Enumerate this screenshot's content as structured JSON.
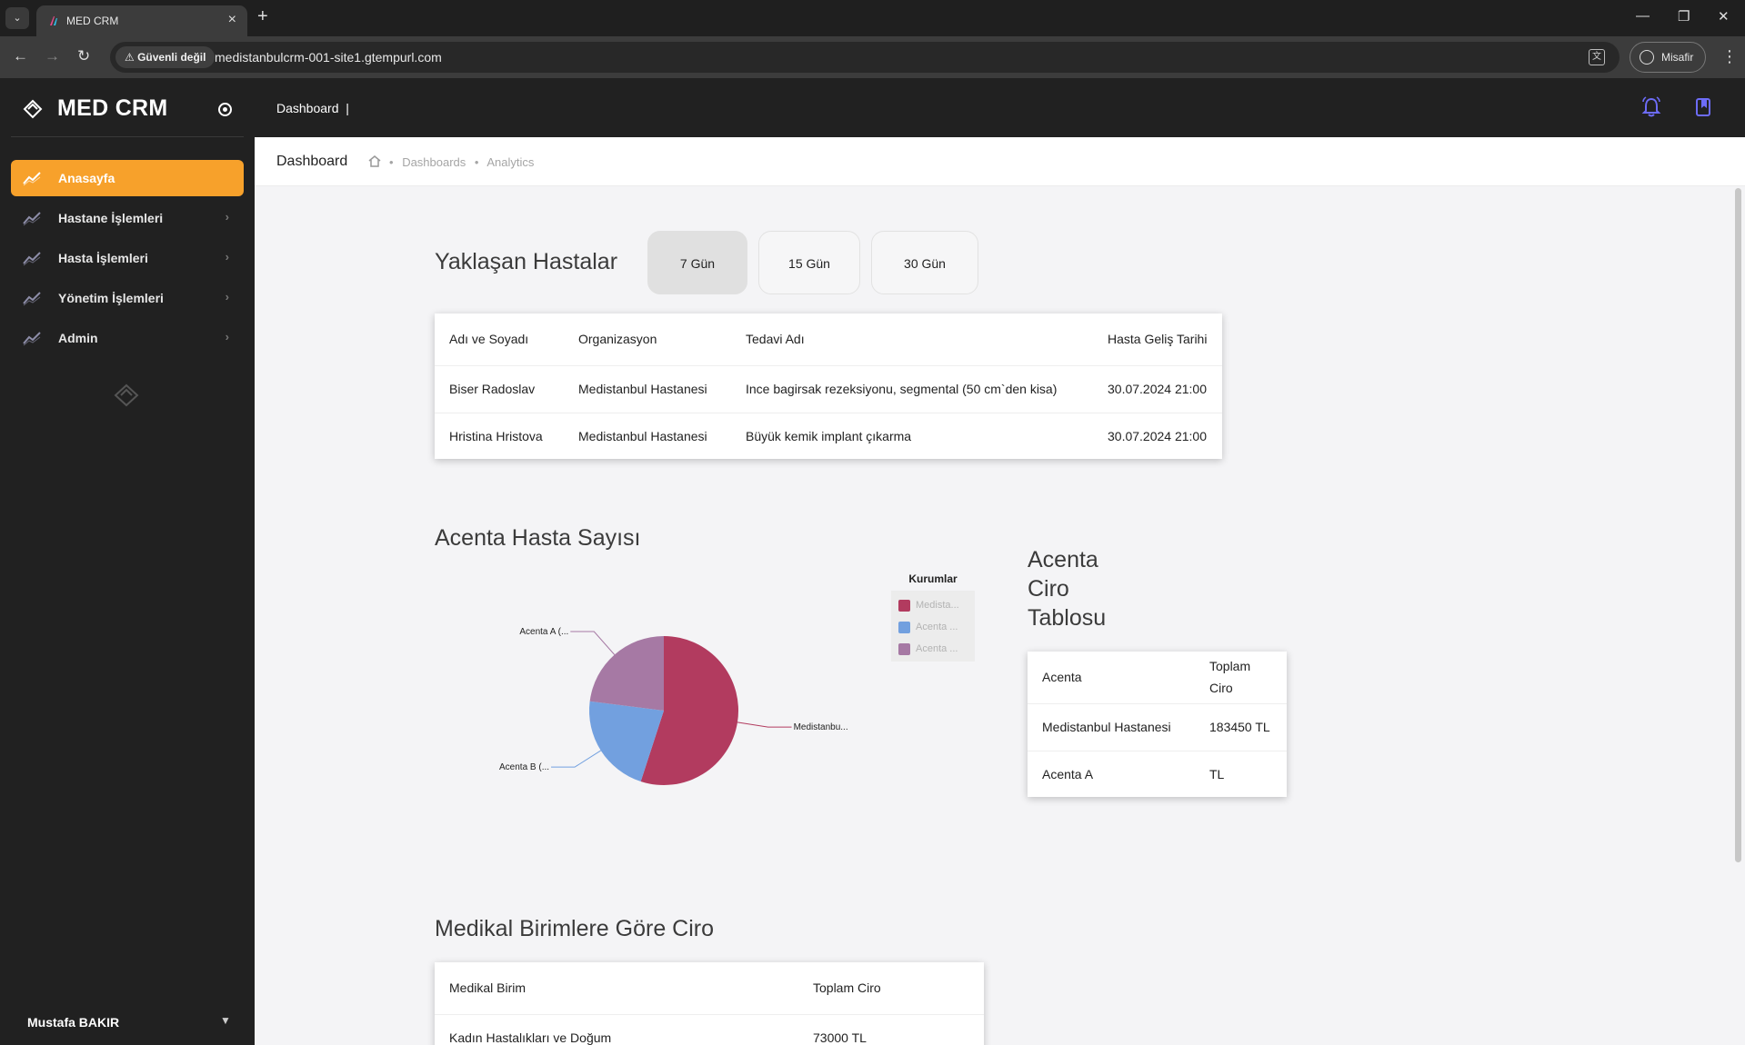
{
  "browser": {
    "tab_title": "MED CRM",
    "security_label": "Güvenli değil",
    "url": "medistanbulcrm-001-site1.gtempurl.com",
    "profile_label": "Misafir"
  },
  "app": {
    "brand": "MED CRM",
    "user_name": "Mustafa BAKIR",
    "accent_color": "#f7a12b"
  },
  "sidebar": {
    "items": [
      {
        "label": "Anasayfa"
      },
      {
        "label": "Hastane İşlemleri"
      },
      {
        "label": "Hasta İşlemleri"
      },
      {
        "label": "Yönetim İşlemleri"
      },
      {
        "label": "Admin"
      }
    ]
  },
  "topbar": {
    "title": "Dashboard  |"
  },
  "breadcrumb": {
    "title": "Dashboard",
    "items": [
      "Dashboards",
      "Analytics"
    ]
  },
  "upcoming": {
    "title": "Yaklaşan Hastalar",
    "filters": [
      "7 Gün",
      "15 Gün",
      "30 Gün"
    ],
    "headers": [
      "Adı ve Soyadı",
      "Organizasyon",
      "Tedavi Adı",
      "Hasta Geliş Tarihi"
    ],
    "rows": [
      [
        "Biser Radoslav",
        "Medistanbul Hastanesi",
        "Ince bagirsak rezeksiyonu, segmental (50 cm`den kisa)",
        "30.07.2024 21:00"
      ],
      [
        "Hristina Hristova",
        "Medistanbul Hastanesi",
        "Büyük kemik implant çıkarma",
        "30.07.2024 21:00"
      ]
    ]
  },
  "agency_patients": {
    "title": "Acenta Hasta Sayısı",
    "legend_title": "Kurumlar",
    "legend_labels": [
      "Medista...",
      "Acenta ...",
      "Acenta ..."
    ],
    "slice_labels": [
      "Medistanbu...",
      "Acenta B (...",
      "Acenta A (..."
    ]
  },
  "chart_data": {
    "type": "pie",
    "title": "Acenta Hasta Sayısı",
    "categories": [
      "Medistanbul Hastanesi",
      "Acenta B",
      "Acenta A"
    ],
    "values": [
      55,
      22,
      23
    ],
    "colors": [
      "#b23b5f",
      "#72a0df",
      "#a679a4"
    ],
    "legend": "right"
  },
  "agency_revenue": {
    "title_lines": [
      "Acenta",
      "Ciro",
      "Tablosu"
    ],
    "headers": [
      "Acenta",
      "Toplam Ciro"
    ],
    "rows": [
      [
        "Medistanbul Hastanesi",
        "183450 TL"
      ],
      [
        "Acenta A",
        "TL"
      ]
    ]
  },
  "medical_revenue": {
    "title": "Medikal Birimlere Göre Ciro",
    "headers": [
      "Medikal Birim",
      "Toplam Ciro"
    ],
    "rows": [
      [
        "Kadın Hastalıkları ve Doğum",
        "73000 TL"
      ]
    ]
  }
}
